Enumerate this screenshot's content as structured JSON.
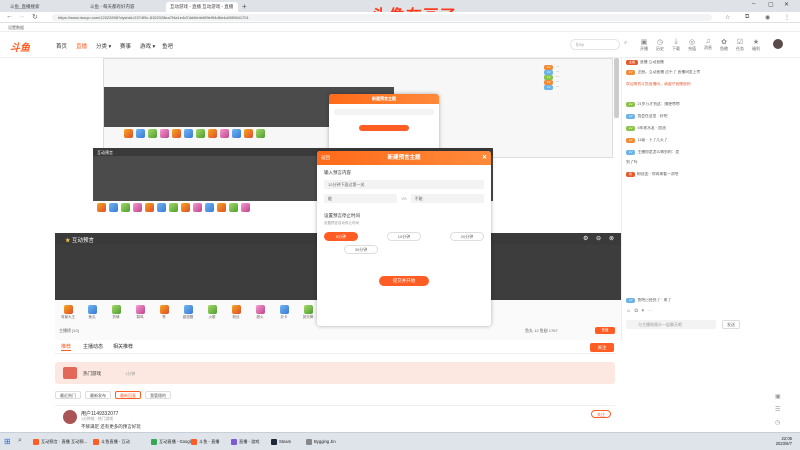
{
  "overlay_caption": "头像在画了",
  "browser": {
    "tabs": [
      {
        "label": "斗鱼_直播搜索",
        "active": false
      },
      {
        "label": "斗鱼 - 每天都有好内容",
        "active": false
      },
      {
        "label": "互动游戏 - 直播 互动游戏 - 直播",
        "active": true
      }
    ],
    "new_tab": "+",
    "url": "https://www.douyu.com/12022898?dyshid=2374f9c-8102028ea7f4a1e4d7dd4fe4ef69e9f4d6e4a00f0841701",
    "bookmark": "设置数据"
  },
  "site": {
    "logo": "斗鱼",
    "nav": [
      {
        "label": "首页",
        "active": false
      },
      {
        "label": "直播",
        "active": true
      },
      {
        "label": "分类 ▾",
        "active": false
      },
      {
        "label": "赛事",
        "active": false
      },
      {
        "label": "游戏 ▾",
        "active": false
      },
      {
        "label": "鱼吧",
        "active": false
      }
    ],
    "search_placeholder": "fpsy",
    "header_icons": [
      "开播",
      "历史",
      "下载",
      "充值",
      "消息",
      "鱼粮",
      "任务",
      "福利"
    ]
  },
  "video": {
    "overlay_title": "互动预言",
    "dialog_small_title": "新建预言主题",
    "dialog_large": {
      "title": "新建预言主题",
      "back": "返回",
      "section_topic": "输入预言内容",
      "topic_value": "12分钟下面过第一关",
      "option_a": "能",
      "vs": "VS",
      "option_b": "不能",
      "section_time": "设置预言停止时间",
      "time_hint": "设置预言自动停止时间",
      "times": [
        "5分钟",
        "10分钟",
        "20分钟",
        "30分钟"
      ],
      "submit": "提交并开始"
    },
    "gift_labels": [
      "背景大王",
      "鱼丸",
      "热情",
      "弱鸡",
      "赞",
      "甜甜圈",
      "火箭",
      "粉丝",
      "超火",
      "办卡",
      "荧光棒",
      "能量"
    ],
    "footer_left": "主播榜 [10]",
    "footer_right": "鱼丸 12  鱼翅 1767"
  },
  "chat": {
    "lines": [
      "直播  互动直播",
      "注册，互动直播  过不了 直播间里上传",
      "欢迎来到斗鱼直播间，请遵守直播规则",
      "21岁万才到这：随便唠唠",
      "我会在这里 · 好吧",
      "5年老水友 · 加油",
      "11级 · 下了几天了",
      "主播你是怎么做到的：是",
      "到了吗",
      "粉丝团 · 你再来看一次吧",
      "鱼吧已经到了 · 来了"
    ],
    "input_placeholder": "与主播和观众一起聊天吧",
    "send": "发送"
  },
  "below": {
    "tabs": [
      {
        "label": "推荐",
        "active": true
      },
      {
        "label": "主播动态",
        "active": false
      },
      {
        "label": "相关推荐",
        "active": false
      }
    ],
    "follow_button": "关注",
    "banner_label": "热门游戏",
    "banner_tag": "1分钟",
    "subtabs": [
      {
        "label": "最近热门",
        "active": false
      },
      {
        "label": "最新发布",
        "active": false
      },
      {
        "label": "最新回复",
        "active": true
      },
      {
        "label": "我管理的",
        "active": false
      }
    ],
    "post_user": "用户1149332077",
    "post_meta": "1分钟前 · 热门游戏",
    "post_text": "不够满足  还有更多的预言好玩",
    "post_follow": "关注"
  },
  "taskbar": {
    "items": [
      "互动预言 · 直播 互动预...",
      "斗鱼直播 - 互动",
      "互动直播 - Google...",
      "斗鱼 - 直播",
      "直播 - 游戏",
      "Steam",
      "Bygging Jin"
    ],
    "time": "22:05",
    "date": "2023/6/7"
  }
}
